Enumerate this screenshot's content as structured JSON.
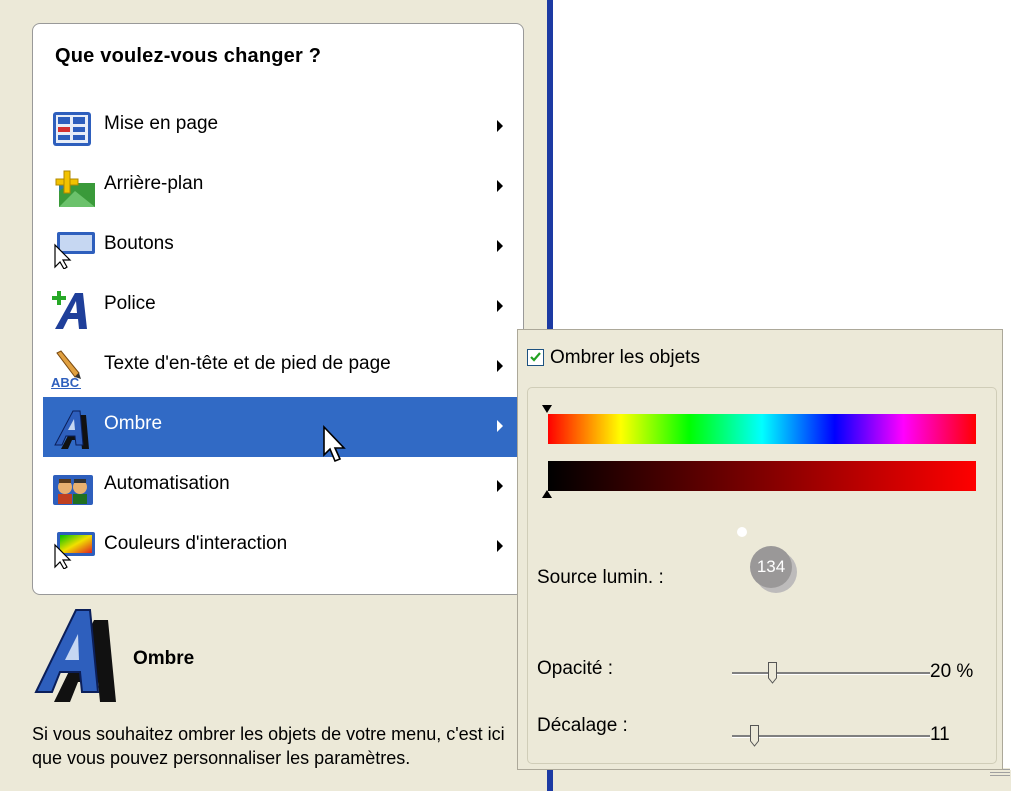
{
  "menu": {
    "title": "Que voulez-vous changer ?",
    "items": [
      {
        "label": "Mise en page",
        "icon": "layout-icon"
      },
      {
        "label": "Arrière-plan",
        "icon": "background-icon"
      },
      {
        "label": "Boutons",
        "icon": "buttons-icon"
      },
      {
        "label": "Police",
        "icon": "font-icon"
      },
      {
        "label": "Texte d'en-tête et de pied de page",
        "icon": "header-footer-text-icon"
      },
      {
        "label": "Ombre",
        "icon": "shadow-icon",
        "selected": true
      },
      {
        "label": "Automatisation",
        "icon": "automation-icon"
      },
      {
        "label": "Couleurs d'interaction",
        "icon": "interaction-colors-icon"
      }
    ]
  },
  "description": {
    "title": "Ombre",
    "text": "Si vous souhaitez ombrer les objets de votre menu, c'est ici que vous pouvez personnaliser les paramètres."
  },
  "shadow_panel": {
    "checkbox_label": "Ombrer les objets",
    "checkbox_checked": true,
    "hue_position": 0,
    "shade_position": 0,
    "light_source_label": "Source lumin. :",
    "light_source_value": "134",
    "opacity_label": "Opacité :",
    "opacity_value": "20 %",
    "opacity_fraction": 0.2,
    "offset_label": "Décalage :",
    "offset_value": "11",
    "offset_fraction": 0.11
  },
  "colors": {
    "accent": "#316ac5",
    "divider": "#1c3aa3",
    "panel_bg": "#ece9d8"
  }
}
